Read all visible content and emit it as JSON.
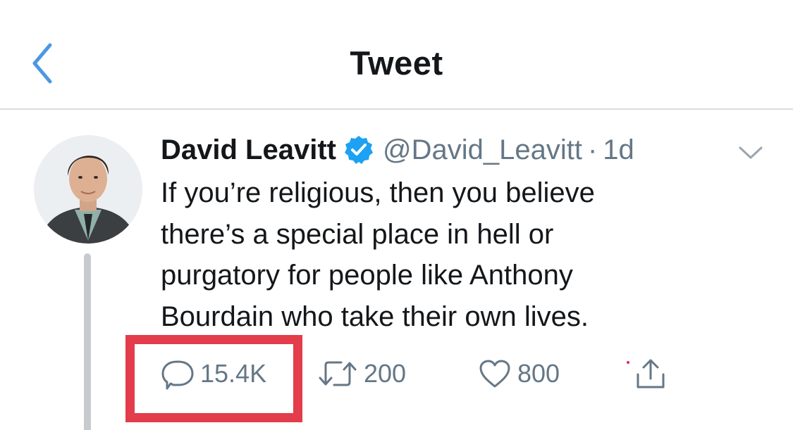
{
  "nav": {
    "title": "Tweet",
    "back_icon": "chevron-left-icon",
    "accent_color": "#4a98e3"
  },
  "tweet": {
    "display_name": "David Leavitt",
    "verified": true,
    "verified_icon": "verified-badge-icon",
    "handle": "@David_Leavitt",
    "separator": "·",
    "timestamp": "1d",
    "text": "If you’re religious, then you believe\nthere’s a special place in hell or\npurgatory for people like Anthony\nBourdain who take their own lives.",
    "caret_icon": "chevron-down-icon"
  },
  "actions": {
    "reply": {
      "icon": "reply-bubble-icon",
      "count": "15.4K"
    },
    "retweet": {
      "icon": "retweet-icon",
      "count": "200"
    },
    "like": {
      "icon": "heart-icon",
      "count": "800"
    },
    "share": {
      "icon": "share-upload-icon"
    }
  },
  "annotation": {
    "highlight_color": "#e33c4a",
    "highlight_target": "reply-count"
  }
}
